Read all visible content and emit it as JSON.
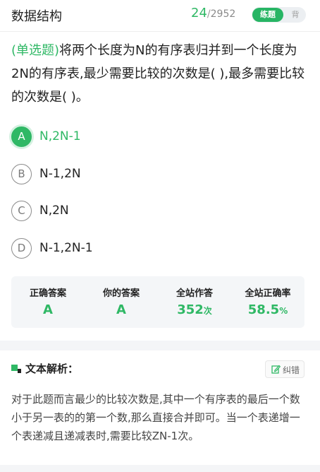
{
  "header": {
    "title": "数据结构",
    "current": "24",
    "slash": "/",
    "total": "2952",
    "mode_active": "练题",
    "mode_inactive": "背"
  },
  "question": {
    "type_tag": "(单选题)",
    "text": "将两个长度为N的有序表归并到一个长度为2N的有序表,最少需要比较的次数是(        ),最多需要比较的次数是(        )。"
  },
  "options": [
    {
      "letter": "A",
      "text": "N,2N-1",
      "selected": true
    },
    {
      "letter": "B",
      "text": "N-1,2N",
      "selected": false
    },
    {
      "letter": "C",
      "text": "N,2N",
      "selected": false
    },
    {
      "letter": "D",
      "text": "N-1,2N-1",
      "selected": false
    }
  ],
  "stats": [
    {
      "label": "正确答案",
      "value": "A",
      "unit": ""
    },
    {
      "label": "你的答案",
      "value": "A",
      "unit": ""
    },
    {
      "label": "全站作答",
      "value": "352",
      "unit": "次"
    },
    {
      "label": "全站正确率",
      "value": "58.5",
      "unit": "%"
    }
  ],
  "analysis": {
    "label": "文本解析：",
    "report_label": "纠错",
    "report_icon": "edit-icon",
    "heading_icon": "analysis-icon",
    "text": "对于此题而言最少的比较次数是,其中一个有序表的最后一个数小于另一表的的第一个数,那么直接合并即可。当一个表递增一个表递减且递减表时,需要比较ZN-1次。"
  },
  "colors": {
    "accent": "#2fb865",
    "background": "#f4f5f7"
  }
}
